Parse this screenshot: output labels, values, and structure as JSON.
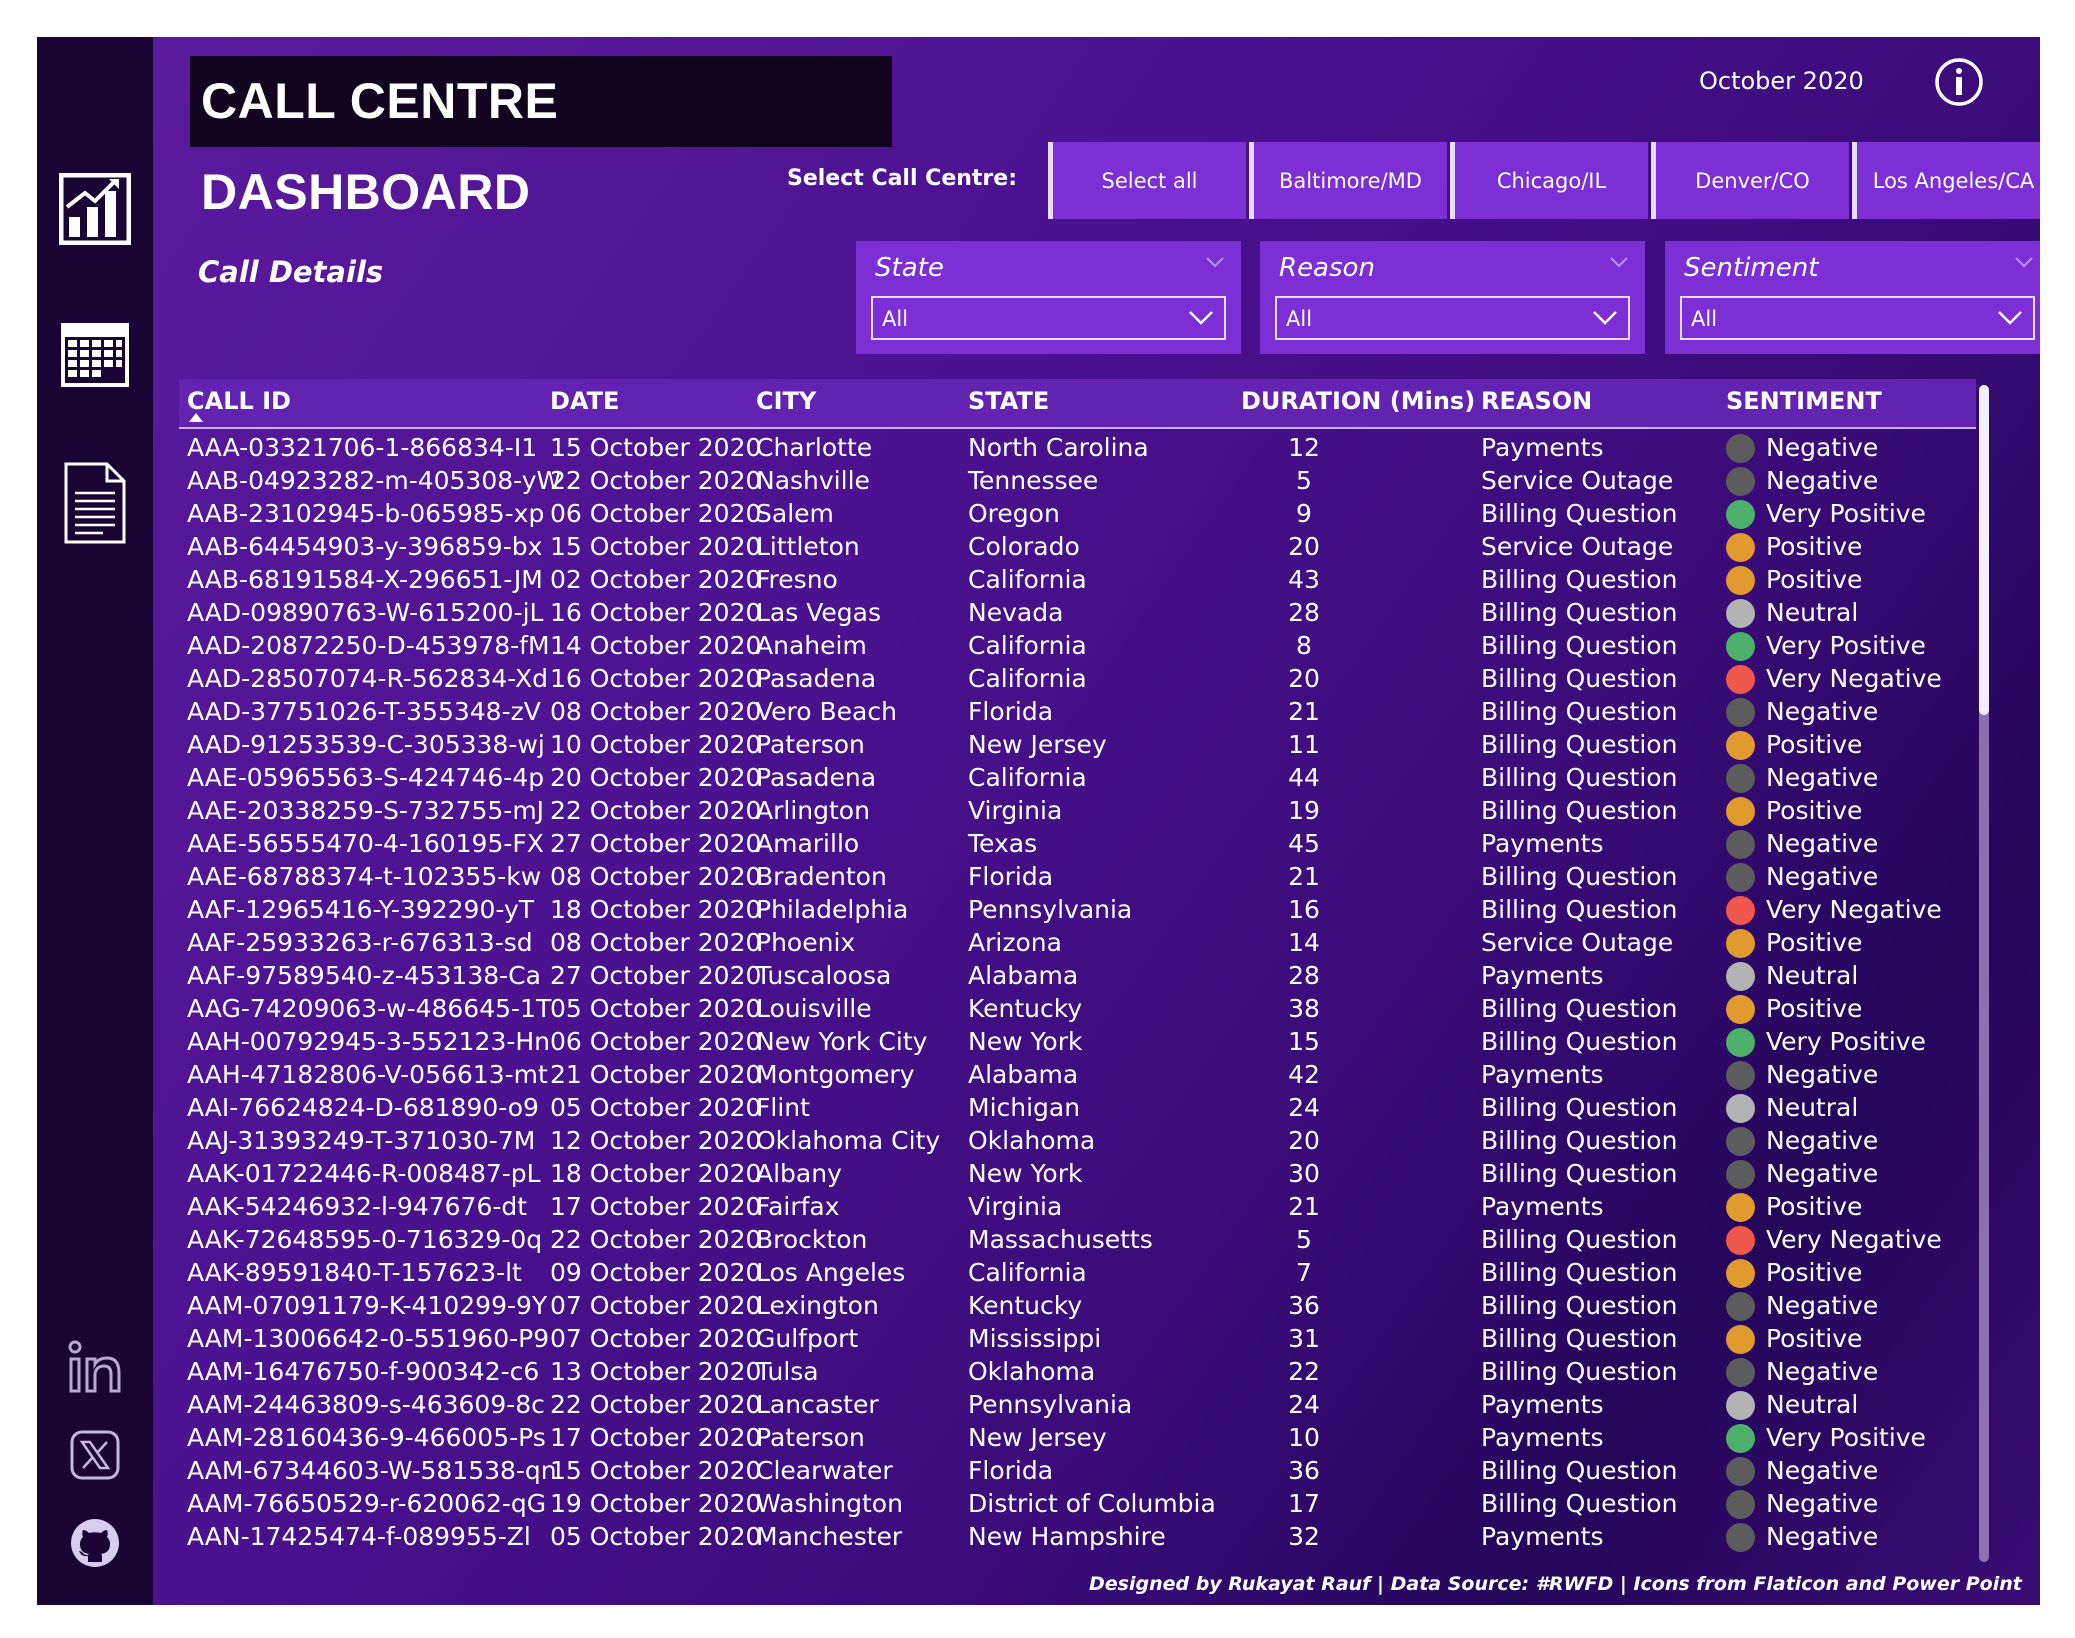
{
  "header": {
    "title": "CALL CENTRE DASHBOARD",
    "month": "October 2020"
  },
  "call_centre": {
    "label": "Select Call Centre:",
    "options": [
      "Select all",
      "Baltimore/MD",
      "Chicago/IL",
      "Denver/CO",
      "Los Angeles/CA"
    ]
  },
  "section_title": "Call Details",
  "filters": [
    {
      "label": "State",
      "value": "All"
    },
    {
      "label": "Reason",
      "value": "All"
    },
    {
      "label": "Sentiment",
      "value": "All"
    }
  ],
  "table": {
    "columns": [
      "CALL ID",
      "DATE",
      "CITY",
      "STATE",
      "DURATION (Mins)",
      "REASON",
      "SENTIMENT"
    ],
    "rows": [
      [
        "AAA-03321706-1-866834-I1",
        "15 October 2020",
        "Charlotte",
        "North Carolina",
        "12",
        "Payments",
        "Negative"
      ],
      [
        "AAB-04923282-m-405308-yW",
        "22 October 2020",
        "Nashville",
        "Tennessee",
        "5",
        "Service Outage",
        "Negative"
      ],
      [
        "AAB-23102945-b-065985-xp",
        "06 October 2020",
        "Salem",
        "Oregon",
        "9",
        "Billing Question",
        "Very Positive"
      ],
      [
        "AAB-64454903-y-396859-bx",
        "15 October 2020",
        "Littleton",
        "Colorado",
        "20",
        "Service Outage",
        "Positive"
      ],
      [
        "AAB-68191584-X-296651-JM",
        "02 October 2020",
        "Fresno",
        "California",
        "43",
        "Billing Question",
        "Positive"
      ],
      [
        "AAD-09890763-W-615200-jL",
        "16 October 2020",
        "Las Vegas",
        "Nevada",
        "28",
        "Billing Question",
        "Neutral"
      ],
      [
        "AAD-20872250-D-453978-fM",
        "14 October 2020",
        "Anaheim",
        "California",
        "8",
        "Billing Question",
        "Very Positive"
      ],
      [
        "AAD-28507074-R-562834-Xd",
        "16 October 2020",
        "Pasadena",
        "California",
        "20",
        "Billing Question",
        "Very Negative"
      ],
      [
        "AAD-37751026-T-355348-zV",
        "08 October 2020",
        "Vero Beach",
        "Florida",
        "21",
        "Billing Question",
        "Negative"
      ],
      [
        "AAD-91253539-C-305338-wj",
        "10 October 2020",
        "Paterson",
        "New Jersey",
        "11",
        "Billing Question",
        "Positive"
      ],
      [
        "AAE-05965563-S-424746-4p",
        "20 October 2020",
        "Pasadena",
        "California",
        "44",
        "Billing Question",
        "Negative"
      ],
      [
        "AAE-20338259-S-732755-mJ",
        "22 October 2020",
        "Arlington",
        "Virginia",
        "19",
        "Billing Question",
        "Positive"
      ],
      [
        "AAE-56555470-4-160195-FX",
        "27 October 2020",
        "Amarillo",
        "Texas",
        "45",
        "Payments",
        "Negative"
      ],
      [
        "AAE-68788374-t-102355-kw",
        "08 October 2020",
        "Bradenton",
        "Florida",
        "21",
        "Billing Question",
        "Negative"
      ],
      [
        "AAF-12965416-Y-392290-yT",
        "18 October 2020",
        "Philadelphia",
        "Pennsylvania",
        "16",
        "Billing Question",
        "Very Negative"
      ],
      [
        "AAF-25933263-r-676313-sd",
        "08 October 2020",
        "Phoenix",
        "Arizona",
        "14",
        "Service Outage",
        "Positive"
      ],
      [
        "AAF-97589540-z-453138-Ca",
        "27 October 2020",
        "Tuscaloosa",
        "Alabama",
        "28",
        "Payments",
        "Neutral"
      ],
      [
        "AAG-74209063-w-486645-1T",
        "05 October 2020",
        "Louisville",
        "Kentucky",
        "38",
        "Billing Question",
        "Positive"
      ],
      [
        "AAH-00792945-3-552123-Hn",
        "06 October 2020",
        "New York City",
        "New York",
        "15",
        "Billing Question",
        "Very Positive"
      ],
      [
        "AAH-47182806-V-056613-mt",
        "21 October 2020",
        "Montgomery",
        "Alabama",
        "42",
        "Payments",
        "Negative"
      ],
      [
        "AAI-76624824-D-681890-o9",
        "05 October 2020",
        "Flint",
        "Michigan",
        "24",
        "Billing Question",
        "Neutral"
      ],
      [
        "AAJ-31393249-T-371030-7M",
        "12 October 2020",
        "Oklahoma City",
        "Oklahoma",
        "20",
        "Billing Question",
        "Negative"
      ],
      [
        "AAK-01722446-R-008487-pL",
        "18 October 2020",
        "Albany",
        "New York",
        "30",
        "Billing Question",
        "Negative"
      ],
      [
        "AAK-54246932-l-947676-dt",
        "17 October 2020",
        "Fairfax",
        "Virginia",
        "21",
        "Payments",
        "Positive"
      ],
      [
        "AAK-72648595-0-716329-0q",
        "22 October 2020",
        "Brockton",
        "Massachusetts",
        "5",
        "Billing Question",
        "Very Negative"
      ],
      [
        "AAK-89591840-T-157623-lt",
        "09 October 2020",
        "Los Angeles",
        "California",
        "7",
        "Billing Question",
        "Positive"
      ],
      [
        "AAM-07091179-K-410299-9Y",
        "07 October 2020",
        "Lexington",
        "Kentucky",
        "36",
        "Billing Question",
        "Negative"
      ],
      [
        "AAM-13006642-0-551960-P9",
        "07 October 2020",
        "Gulfport",
        "Mississippi",
        "31",
        "Billing Question",
        "Positive"
      ],
      [
        "AAM-16476750-f-900342-c6",
        "13 October 2020",
        "Tulsa",
        "Oklahoma",
        "22",
        "Billing Question",
        "Negative"
      ],
      [
        "AAM-24463809-s-463609-8c",
        "22 October 2020",
        "Lancaster",
        "Pennsylvania",
        "24",
        "Payments",
        "Neutral"
      ],
      [
        "AAM-28160436-9-466005-Ps",
        "17 October 2020",
        "Paterson",
        "New Jersey",
        "10",
        "Payments",
        "Very Positive"
      ],
      [
        "AAM-67344603-W-581538-qn",
        "15 October 2020",
        "Clearwater",
        "Florida",
        "36",
        "Billing Question",
        "Negative"
      ],
      [
        "AAM-76650529-r-620062-qG",
        "19 October 2020",
        "Washington",
        "District of Columbia",
        "17",
        "Billing Question",
        "Negative"
      ],
      [
        "AAN-17425474-f-089955-Zl",
        "05 October 2020",
        "Manchester",
        "New Hampshire",
        "32",
        "Payments",
        "Negative"
      ]
    ]
  },
  "sentiment_colors": {
    "Negative": "#5c5c5c",
    "Very Positive": "#4caf6a",
    "Positive": "#e09a2e",
    "Neutral": "#b3b3b3",
    "Very Negative": "#f0584d"
  },
  "colors": {
    "sidebar": "#1a0433",
    "accent": "#7b2fd4",
    "header_row": "#6223b0"
  },
  "icons": {
    "sidebar": [
      "bar-chart-icon",
      "calendar-icon",
      "document-icon",
      "linkedin-icon",
      "x-twitter-icon",
      "github-icon"
    ],
    "header": [
      "info-icon"
    ]
  },
  "footer": "Designed by Rukayat Rauf | Data Source: #RWFD | Icons from Flaticon and Power Point"
}
